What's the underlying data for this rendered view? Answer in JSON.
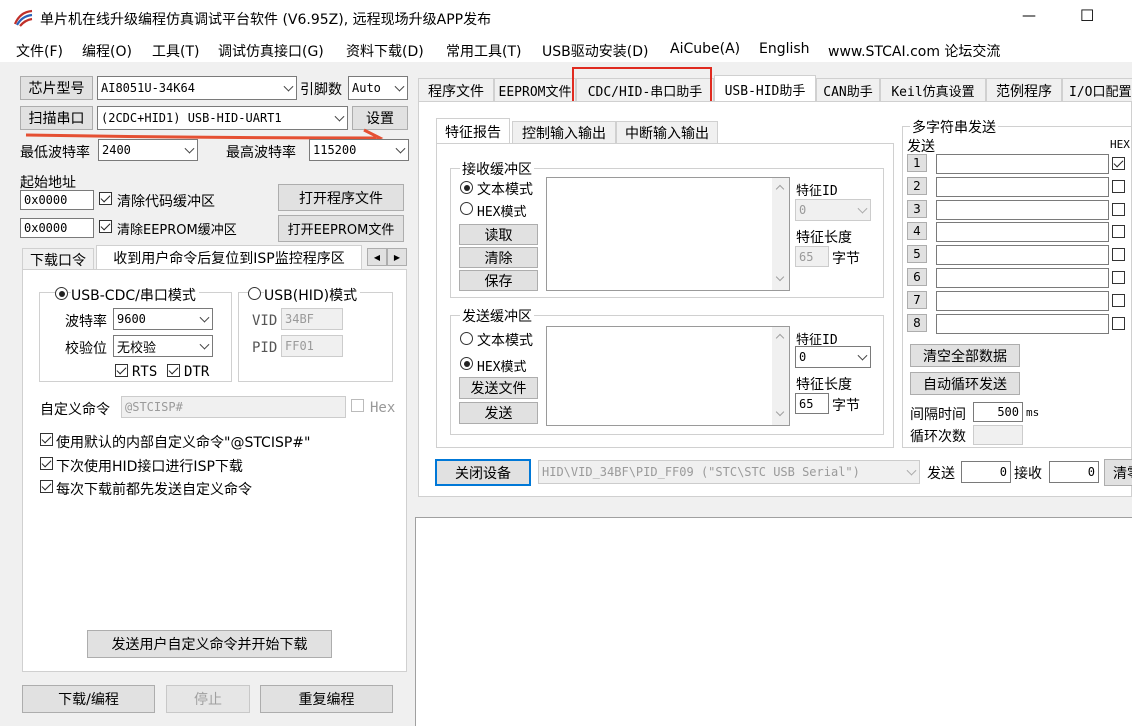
{
  "window": {
    "title": "单片机在线升级编程仿真调试平台软件 (V6.95Z), 远程现场升级APP发布",
    "minimize": "—",
    "maximize": "☐"
  },
  "menu": [
    "文件(F)",
    "编程(O)",
    "工具(T)",
    "调试仿真接口(G)",
    "资料下载(D)",
    "常用工具(T)",
    "USB驱动安装(D)",
    "AiCube(A)",
    "English",
    "www.STCAI.com 论坛交流"
  ],
  "left": {
    "chip_btn": "芯片型号",
    "chip_value": "AI8051U-34K64",
    "pins_label": "引脚数",
    "pins_value": "Auto",
    "scan_btn": "扫描串口",
    "port_value": "(2CDC+HID1) USB-HID-UART1",
    "settings_btn": "设置",
    "min_baud_label": "最低波特率",
    "min_baud_value": "2400",
    "max_baud_label": "最高波特率",
    "max_baud_value": "115200",
    "start_addr_label": "起始地址",
    "addr1": "0x0000",
    "clear_code": "清除代码缓冲区",
    "open_prog": "打开程序文件",
    "addr2": "0x0000",
    "clear_eeprom": "清除EEPROM缓冲区",
    "open_eeprom": "打开EEPROM文件",
    "tab_download": "下载口令",
    "tab_reset": "收到用户命令后复位到ISP监控程序区",
    "scroll_left": "◀",
    "scroll_right": "▶",
    "cdc_mode": "USB-CDC/串口模式",
    "hid_mode": "USB(HID)模式",
    "baud_label": "波特率",
    "baud_value": "9600",
    "parity_label": "校验位",
    "parity_value": "无校验",
    "rts": "RTS",
    "dtr": "DTR",
    "vid_label": "VID",
    "vid_value": "34BF",
    "pid_label": "PID",
    "pid_value": "FF01",
    "custom_cmd_label": "自定义命令",
    "custom_cmd_value": "@STCISP#",
    "hex_label": "Hex",
    "opt1": "使用默认的内部自定义命令\"@STCISP#\"",
    "opt2": "下次使用HID接口进行ISP下载",
    "opt3": "每次下载前都先发送自定义命令",
    "send_cmd_btn": "发送用户自定义命令并开始下载",
    "download_btn": "下载/编程",
    "stop_btn": "停止",
    "reprogram_btn": "重复编程"
  },
  "tabs": [
    "程序文件",
    "EEPROM文件",
    "CDC/HID-串口助手",
    "USB-HID助手",
    "CAN助手",
    "Keil仿真设置",
    "范例程序",
    "I/O口配置"
  ],
  "hid": {
    "subtabs": [
      "特征报告",
      "控制输入输出",
      "中断输入输出"
    ],
    "recv_title": "接收缓冲区",
    "text_mode": "文本模式",
    "hex_mode": "HEX模式",
    "read_btn": "读取",
    "clear_btn": "清除",
    "save_btn": "保存",
    "feature_id_label": "特征ID",
    "recv_id": "0",
    "feature_len_label": "特征长度",
    "recv_len": "65",
    "bytes": "字节",
    "send_title": "发送缓冲区",
    "send_file_btn": "发送文件",
    "send_btn": "发送",
    "send_id": "0",
    "send_len": "65",
    "multi_title": "多字符串发送",
    "send_col": "发送",
    "hex_col": "HEX",
    "rows": [
      "1",
      "2",
      "3",
      "4",
      "5",
      "6",
      "7",
      "8"
    ],
    "clear_all": "清空全部数据",
    "auto_loop": "自动循环发送",
    "interval_label": "间隔时间",
    "interval_value": "500",
    "ms": "ms",
    "loop_label": "循环次数",
    "close_dev": "关闭设备",
    "device_value": "HID\\VID_34BF\\PID_FF09 (\"STC\\STC USB Serial\")",
    "tx_label": "发送",
    "tx_value": "0",
    "rx_label": "接收",
    "rx_value": "0",
    "clear_short": "清零"
  },
  "colors": {
    "highlight": "#e02b20",
    "arrow": "#e55033"
  }
}
